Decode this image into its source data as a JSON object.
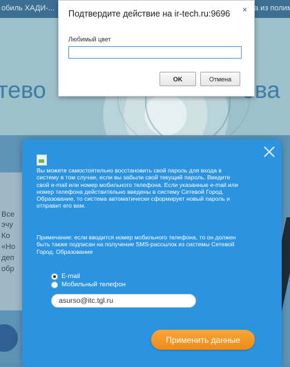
{
  "background": {
    "tab_left": "обиль ХАДИ-...",
    "tab_right": "а из полиме",
    "word_left": "тево",
    "word_right": "ова",
    "left_lines": [
      "Все",
      "эчу",
      "Ко",
      "«Но",
      "деп",
      "обр"
    ]
  },
  "confirm_dialog": {
    "title": "Подтвердите действие на ir-tech.ru:9696",
    "close_symbol": "×",
    "label": "Любимый цвет",
    "input_value": "",
    "ok_label": "OK",
    "cancel_label": "Отмена"
  },
  "recovery": {
    "text_main": "Вы можете самостоятельно восстановить свой пароль для входа в систему в том случае, если вы забыли свой текущий пароль. Введите свой e-mail или номер мобильного телефона. Если указанные e-mail или номер телефона действительно введены в систему Сетевой Город. Образование, то система автоматически сформирует новый пароль и отправит его вам.",
    "text_note": "Примечание: если вводится номер мобильного телефона, то он должен быть также подписан на получение SMS-рассылок из системы Сетевой Город. Образование",
    "option_email": "E-mail",
    "option_phone": "Мобильный телефон",
    "email_value": "asurso@itc.tgl.ru",
    "apply_label": "Применить данные"
  },
  "colors": {
    "modal_bg": "#2c93e0",
    "apply_button": "#f39a22"
  }
}
